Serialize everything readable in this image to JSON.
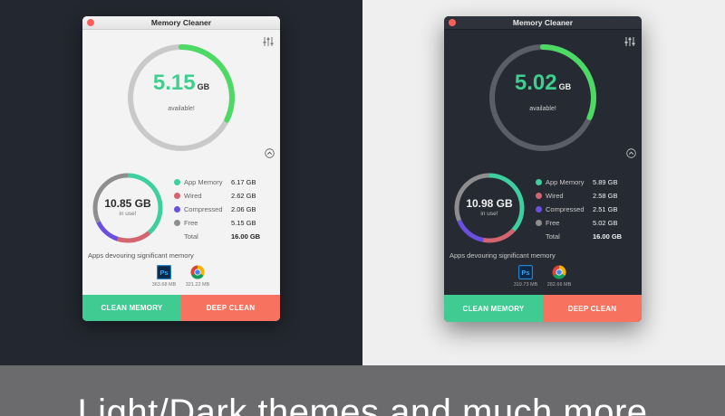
{
  "caption": "Light/Dark themes and much more",
  "colors": {
    "accent_green": "#3ecf8e",
    "app_memory": "#3ecfa0",
    "wired": "#d4656f",
    "compressed": "#6b4fe0",
    "free": "#8e8e8e",
    "clean_button": "#3fcb91",
    "deep_button": "#f7735f"
  },
  "windows": [
    {
      "theme": "light",
      "title": "Memory Cleaner",
      "available": {
        "value": "5.15",
        "unit": "GB",
        "label": "available!"
      },
      "in_use": {
        "value": "10.85 GB",
        "label": "in use!"
      },
      "legend": [
        {
          "label": "App Memory",
          "value": "6.17 GB"
        },
        {
          "label": "Wired",
          "value": "2.62 GB"
        },
        {
          "label": "Compressed",
          "value": "2.06 GB"
        },
        {
          "label": "Free",
          "value": "5.15 GB"
        }
      ],
      "total": {
        "label": "Total",
        "value": "16.00 GB"
      },
      "apps_heading": "Apps devouring significant memory",
      "apps": [
        {
          "icon": "photoshop-icon",
          "size": "363.68 MB"
        },
        {
          "icon": "chrome-icon",
          "size": "321.22 MB"
        }
      ],
      "clean_button": "CLEAN MEMORY",
      "deep_button": "DEEP CLEAN"
    },
    {
      "theme": "dark",
      "title": "Memory Cleaner",
      "available": {
        "value": "5.02",
        "unit": "GB",
        "label": "available!"
      },
      "in_use": {
        "value": "10.98 GB",
        "label": "in use!"
      },
      "legend": [
        {
          "label": "App Memory",
          "value": "5.89 GB"
        },
        {
          "label": "Wired",
          "value": "2.58 GB"
        },
        {
          "label": "Compressed",
          "value": "2.51 GB"
        },
        {
          "label": "Free",
          "value": "5.02 GB"
        }
      ],
      "total": {
        "label": "Total",
        "value": "16.00 GB"
      },
      "apps_heading": "Apps devouring significant memory",
      "apps": [
        {
          "icon": "photoshop-icon",
          "size": "319.73 MB"
        },
        {
          "icon": "chrome-icon",
          "size": "282.66 MB"
        }
      ],
      "clean_button": "CLEAN MEMORY",
      "deep_button": "DEEP CLEAN"
    }
  ]
}
